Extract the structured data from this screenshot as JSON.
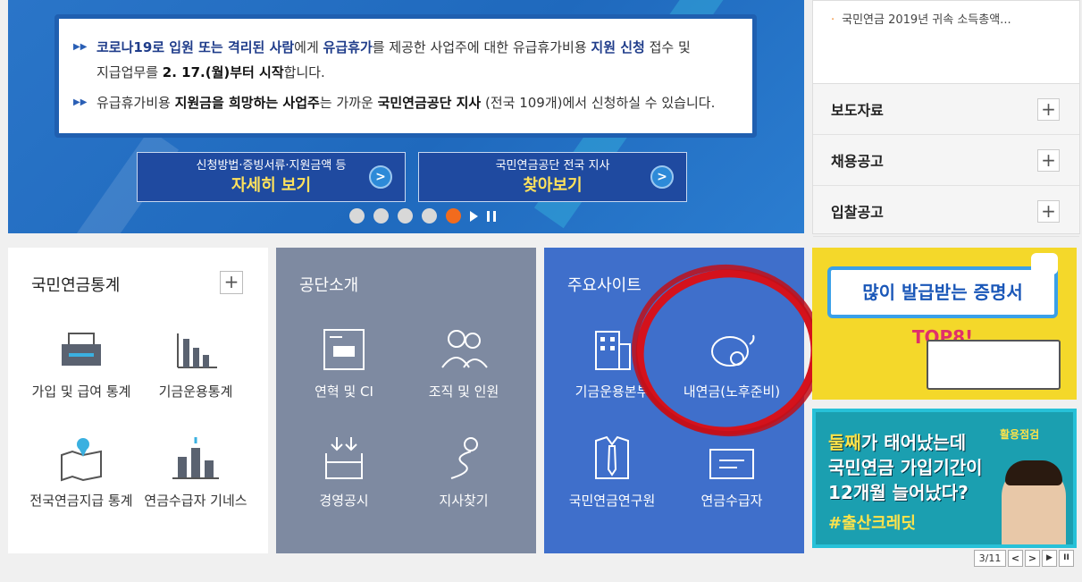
{
  "hero": {
    "notice_lines": [
      {
        "parts": [
          "코로나19로 입원 또는 격리된 사람",
          "에게 ",
          "유급휴가",
          "를 제공한 사업주에 대한 유급휴가비용 ",
          "지원 신청",
          " 접수 및"
        ]
      },
      {
        "parts": [
          "지급업무를 ",
          "2. 17.(월)부터 시작",
          "합니다."
        ]
      },
      {
        "parts": [
          "유급휴가비용 ",
          "지원금을 희망하는 사업주",
          "는 가까운 ",
          "국민연금공단 지사",
          " (전국 109개)에서 신청하실 수 있습니다."
        ]
      }
    ],
    "buttons": [
      {
        "small": "신청방법·증빙서류·지원금액 등",
        "big": "자세히 보기"
      },
      {
        "small": "국민연금공단 전국 지사",
        "big": "찾아보기"
      }
    ],
    "slide_count": 5,
    "active_slide": 5
  },
  "board": {
    "top_item": "국민연금 2019년 귀속 소득총액...",
    "rows": [
      "보도자료",
      "채용공고",
      "입찰공고"
    ]
  },
  "tiles": {
    "stats": {
      "title": "국민연금통계",
      "items": [
        "가입 및 급여 통계",
        "기금운용통계",
        "전국연금지급 통계",
        "연금수급자 기네스"
      ]
    },
    "about": {
      "title": "공단소개",
      "items": [
        "연혁 및 CI",
        "조직 및 인원",
        "경영공시",
        "지사찾기"
      ]
    },
    "sites": {
      "title": "주요사이트",
      "items": [
        "기금운용본부",
        "내연금(노후준비)",
        "국민연금연구원",
        "연금수급자"
      ]
    }
  },
  "ads": {
    "ad1": {
      "prefix": "많이 발급받는 증명서 ",
      "highlight": "TOP8!"
    },
    "ad2": {
      "line1_a": "둘째",
      "line1_b": "가 태어났는데",
      "line2": "국민연금 가입기간이",
      "line3": "12개월 늘어났다?",
      "tag": "#출산크레딧",
      "corner": "활용점검"
    },
    "pager": {
      "count": "3/11",
      "prev": "<",
      "next": ">",
      "play": "▶",
      "pause": "II"
    }
  },
  "colors": {
    "accent_red": "#d4121c",
    "active_dot": "#f26b1d",
    "tile_sites": "#3f6fcb",
    "tile_about": "#7e8aa1"
  }
}
